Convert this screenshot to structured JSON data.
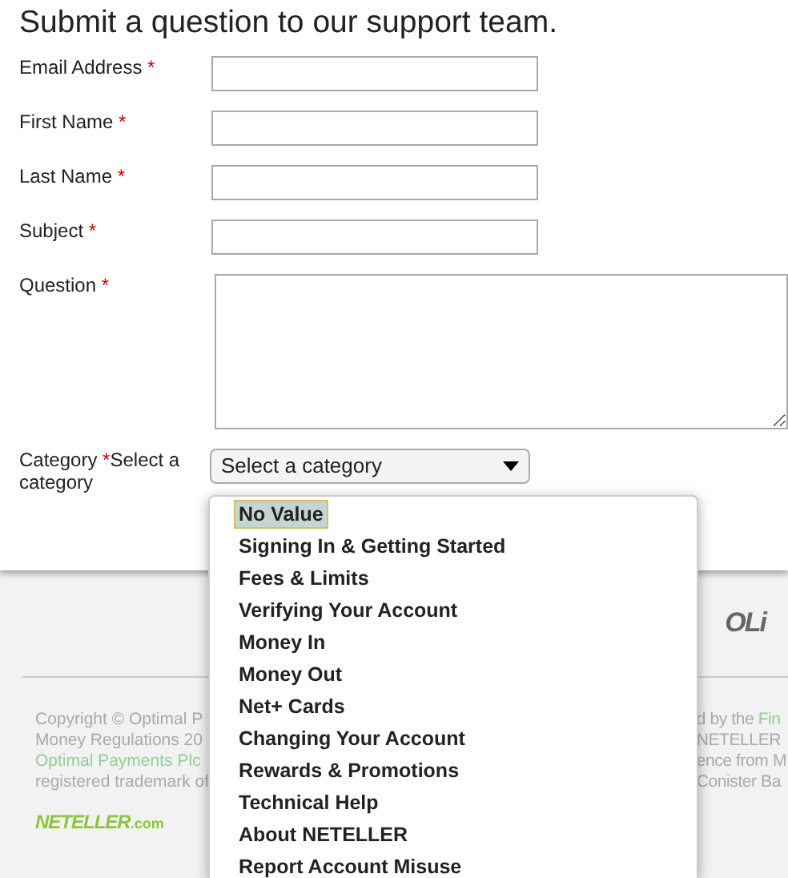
{
  "title": "Submit a question to our support team.",
  "fields": [
    {
      "label": "Email Address",
      "required_mark": "*",
      "kind": "input"
    },
    {
      "label": "First Name",
      "required_mark": "*",
      "kind": "input"
    },
    {
      "label": "Last Name",
      "required_mark": "*",
      "kind": "input"
    },
    {
      "label": "Subject",
      "required_mark": "*",
      "kind": "input"
    },
    {
      "label": "Question",
      "required_mark": "*",
      "kind": "textarea"
    }
  ],
  "category": {
    "label": "Category",
    "required_mark": "*",
    "hint": "Select a category",
    "value": "Select a category"
  },
  "dropdown": {
    "options": [
      {
        "label": "No Value",
        "selected": true
      },
      {
        "label": "Signing In & Getting Started",
        "selected": false
      },
      {
        "label": "Fees & Limits",
        "selected": false
      },
      {
        "label": "Verifying Your Account",
        "selected": false
      },
      {
        "label": "Money In",
        "selected": false
      },
      {
        "label": "Money Out",
        "selected": false
      },
      {
        "label": "Net+ Cards",
        "selected": false
      },
      {
        "label": "Changing Your Account",
        "selected": false
      },
      {
        "label": "Rewards & Promotions",
        "selected": false
      },
      {
        "label": "Technical Help",
        "selected": false
      },
      {
        "label": "About NETELLER",
        "selected": false
      },
      {
        "label": "Report Account Misuse",
        "selected": false
      }
    ]
  },
  "footer": {
    "partner_logo": "OLi",
    "copyright_left": [
      [
        {
          "text": "Copyright © Optimal P",
          "link": false
        }
      ],
      [
        {
          "text": "Money Regulations 20",
          "link": false
        }
      ],
      [
        {
          "text": "Optimal Payments Plc",
          "link": true
        }
      ],
      [
        {
          "text": "registered trademark of",
          "link": false
        }
      ]
    ],
    "copyright_right": [
      [
        {
          "text": "d by the ",
          "link": false
        },
        {
          "text": "Fin",
          "link": true
        }
      ],
      [
        {
          "text": "NETELLER",
          "link": false
        }
      ],
      [
        {
          "text": "ence from M",
          "link": false
        }
      ],
      [
        {
          "text": "Conister Ba",
          "link": false
        }
      ]
    ],
    "logo": {
      "name": "NETELLER",
      "suffix": ".com"
    }
  }
}
